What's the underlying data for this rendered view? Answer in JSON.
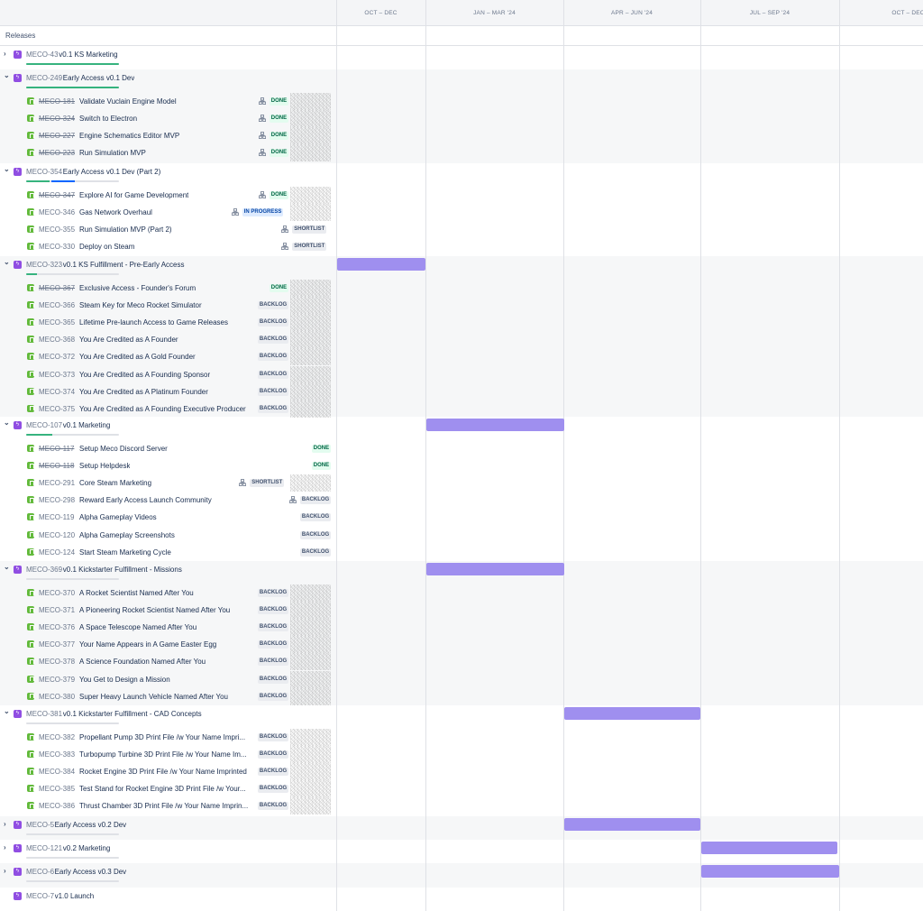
{
  "timeline": {
    "months": [
      "OCT – DEC",
      "JAN – MAR '24",
      "APR – JUN '24",
      "JUL – SEP '24",
      "OCT – DEC"
    ],
    "releases_label": "Releases"
  },
  "colors": {
    "epic": "#904ee2",
    "story": "#63ba3c",
    "bar": "#9f8fef",
    "done": "#36b37e",
    "in_progress": "#0065ff"
  },
  "epics": [
    {
      "key": "MECO-43",
      "title": "v0.1 KS Marketing",
      "expanded": false,
      "progress_done": 1.0,
      "progress_inprog": 0,
      "bar": null,
      "children": []
    },
    {
      "key": "MECO-249",
      "title": "Early Access v0.1 Dev",
      "expanded": true,
      "progress_done": 1.0,
      "progress_inprog": 0,
      "bar": null,
      "children": [
        {
          "key": "MECO-181",
          "title": "Validate Vuclain Engine Model",
          "status": "DONE",
          "done": true,
          "hier": true,
          "avatar": true
        },
        {
          "key": "MECO-324",
          "title": "Switch to Electron",
          "status": "DONE",
          "done": true,
          "hier": true,
          "avatar": true
        },
        {
          "key": "MECO-227",
          "title": "Engine Schematics Editor MVP",
          "status": "DONE",
          "done": true,
          "hier": true,
          "avatar": true
        },
        {
          "key": "MECO-223",
          "title": "Run Simulation MVP",
          "status": "DONE",
          "done": true,
          "hier": true,
          "avatar": true
        }
      ]
    },
    {
      "key": "MECO-354",
      "title": "Early Access v0.1 Dev (Part 2)",
      "expanded": true,
      "progress_done": 0.25,
      "progress_inprog": 0.25,
      "bar": null,
      "children": [
        {
          "key": "MECO-347",
          "title": "Explore AI for Game Development",
          "status": "DONE",
          "done": true,
          "hier": true,
          "avatar": true
        },
        {
          "key": "MECO-346",
          "title": "Gas Network Overhaul",
          "status": "IN PROGRESS",
          "done": false,
          "hier": true,
          "avatar": true
        },
        {
          "key": "MECO-355",
          "title": "Run Simulation MVP (Part 2)",
          "status": "SHORTLIST",
          "done": false,
          "hier": true,
          "avatar": false
        },
        {
          "key": "MECO-330",
          "title": "Deploy on Steam",
          "status": "SHORTLIST",
          "done": false,
          "hier": true,
          "avatar": false
        }
      ]
    },
    {
      "key": "MECO-323",
      "title": "v0.1 KS Fulfillment - Pre-Early Access",
      "expanded": true,
      "progress_done": 0.12,
      "progress_inprog": 0,
      "bar": "q0",
      "children": [
        {
          "key": "MECO-367",
          "title": "Exclusive Access - Founder's Forum",
          "status": "DONE",
          "done": true,
          "hier": false,
          "avatar": true
        },
        {
          "key": "MECO-366",
          "title": "Steam Key for Meco Rocket Simulator",
          "status": "BACKLOG",
          "done": false,
          "hier": false,
          "avatar": true
        },
        {
          "key": "MECO-365",
          "title": "Lifetime Pre-launch Access to Game Releases",
          "status": "BACKLOG",
          "done": false,
          "hier": false,
          "avatar": true
        },
        {
          "key": "MECO-368",
          "title": "You Are Credited as A Founder",
          "status": "BACKLOG",
          "done": false,
          "hier": false,
          "avatar": true
        },
        {
          "key": "MECO-372",
          "title": "You Are Credited as A Gold Founder",
          "status": "BACKLOG",
          "done": false,
          "hier": false,
          "avatar": true
        },
        {
          "key": "MECO-373",
          "title": "You Are Credited as A Founding Sponsor",
          "status": "BACKLOG",
          "done": false,
          "hier": false,
          "avatar": true
        },
        {
          "key": "MECO-374",
          "title": "You Are Credited as A Platinum Founder",
          "status": "BACKLOG",
          "done": false,
          "hier": false,
          "avatar": true
        },
        {
          "key": "MECO-375",
          "title": "You Are Credited as A Founding Executive Producer",
          "status": "BACKLOG",
          "done": false,
          "hier": false,
          "avatar": true
        }
      ]
    },
    {
      "key": "MECO-107",
      "title": "v0.1 Marketing",
      "expanded": true,
      "progress_done": 0.28,
      "progress_inprog": 0,
      "bar": "q1",
      "children": [
        {
          "key": "MECO-117",
          "title": "Setup Meco Discord Server",
          "status": "DONE",
          "done": true,
          "hier": false,
          "avatar": false
        },
        {
          "key": "MECO-118",
          "title": "Setup Helpdesk",
          "status": "DONE",
          "done": true,
          "hier": false,
          "avatar": false
        },
        {
          "key": "MECO-291",
          "title": "Core Steam Marketing",
          "status": "SHORTLIST",
          "done": false,
          "hier": true,
          "avatar": true
        },
        {
          "key": "MECO-298",
          "title": "Reward Early Access Launch Community",
          "status": "BACKLOG",
          "done": false,
          "hier": true,
          "avatar": false
        },
        {
          "key": "MECO-119",
          "title": "Alpha Gameplay Videos",
          "status": "BACKLOG",
          "done": false,
          "hier": false,
          "avatar": false
        },
        {
          "key": "MECO-120",
          "title": "Alpha Gameplay Screenshots",
          "status": "BACKLOG",
          "done": false,
          "hier": false,
          "avatar": false
        },
        {
          "key": "MECO-124",
          "title": "Start Steam Marketing Cycle",
          "status": "BACKLOG",
          "done": false,
          "hier": false,
          "avatar": false
        }
      ]
    },
    {
      "key": "MECO-369",
      "title": "v0.1 Kickstarter Fulfillment - Missions",
      "expanded": true,
      "progress_done": 0,
      "progress_inprog": 0,
      "bar": "q1",
      "children": [
        {
          "key": "MECO-370",
          "title": "A Rocket Scientist Named After You",
          "status": "BACKLOG",
          "done": false,
          "hier": false,
          "avatar": true
        },
        {
          "key": "MECO-371",
          "title": "A Pioneering Rocket Scientist Named After You",
          "status": "BACKLOG",
          "done": false,
          "hier": false,
          "avatar": true
        },
        {
          "key": "MECO-376",
          "title": "A Space Telescope Named After You",
          "status": "BACKLOG",
          "done": false,
          "hier": false,
          "avatar": true
        },
        {
          "key": "MECO-377",
          "title": "Your Name Appears in A Game Easter Egg",
          "status": "BACKLOG",
          "done": false,
          "hier": false,
          "avatar": true
        },
        {
          "key": "MECO-378",
          "title": "A Science Foundation Named After You",
          "status": "BACKLOG",
          "done": false,
          "hier": false,
          "avatar": true
        },
        {
          "key": "MECO-379",
          "title": "You Get to Design a Mission",
          "status": "BACKLOG",
          "done": false,
          "hier": false,
          "avatar": true
        },
        {
          "key": "MECO-380",
          "title": "Super Heavy Launch Vehicle Named After You",
          "status": "BACKLOG",
          "done": false,
          "hier": false,
          "avatar": true
        }
      ]
    },
    {
      "key": "MECO-381",
      "title": "v0.1 Kickstarter Fulfillment - CAD Concepts",
      "expanded": true,
      "progress_done": 0,
      "progress_inprog": 0,
      "bar": "q2",
      "children": [
        {
          "key": "MECO-382",
          "title": "Propellant Pump 3D Print File /w Your Name Impri...",
          "status": "BACKLOG",
          "done": false,
          "hier": false,
          "avatar": true
        },
        {
          "key": "MECO-383",
          "title": "Turbopump Turbine 3D Print File /w Your Name Im...",
          "status": "BACKLOG",
          "done": false,
          "hier": false,
          "avatar": true
        },
        {
          "key": "MECO-384",
          "title": "Rocket Engine 3D Print File /w Your Name Imprinted",
          "status": "BACKLOG",
          "done": false,
          "hier": false,
          "avatar": true
        },
        {
          "key": "MECO-385",
          "title": "Test Stand for Rocket Engine 3D Print File /w Your...",
          "status": "BACKLOG",
          "done": false,
          "hier": false,
          "avatar": true
        },
        {
          "key": "MECO-386",
          "title": "Thrust Chamber 3D Print File /w Your Name Imprin...",
          "status": "BACKLOG",
          "done": false,
          "hier": false,
          "avatar": true
        }
      ]
    },
    {
      "key": "MECO-5",
      "title": "Early Access v0.2 Dev",
      "expanded": false,
      "progress_done": 0,
      "progress_inprog": 0,
      "bar": "q2",
      "children": []
    },
    {
      "key": "MECO-121",
      "title": "v0.2 Marketing",
      "expanded": false,
      "progress_done": 0,
      "progress_inprog": 0,
      "bar": "q3",
      "children": []
    },
    {
      "key": "MECO-6",
      "title": "Early Access v0.3 Dev",
      "expanded": false,
      "progress_done": 0,
      "progress_inprog": 0,
      "bar": "q3b",
      "children": []
    },
    {
      "key": "MECO-7",
      "title": "v1.0 Launch",
      "expanded": null,
      "progress_done": 0,
      "progress_inprog": 0,
      "bar": null,
      "children": []
    }
  ]
}
